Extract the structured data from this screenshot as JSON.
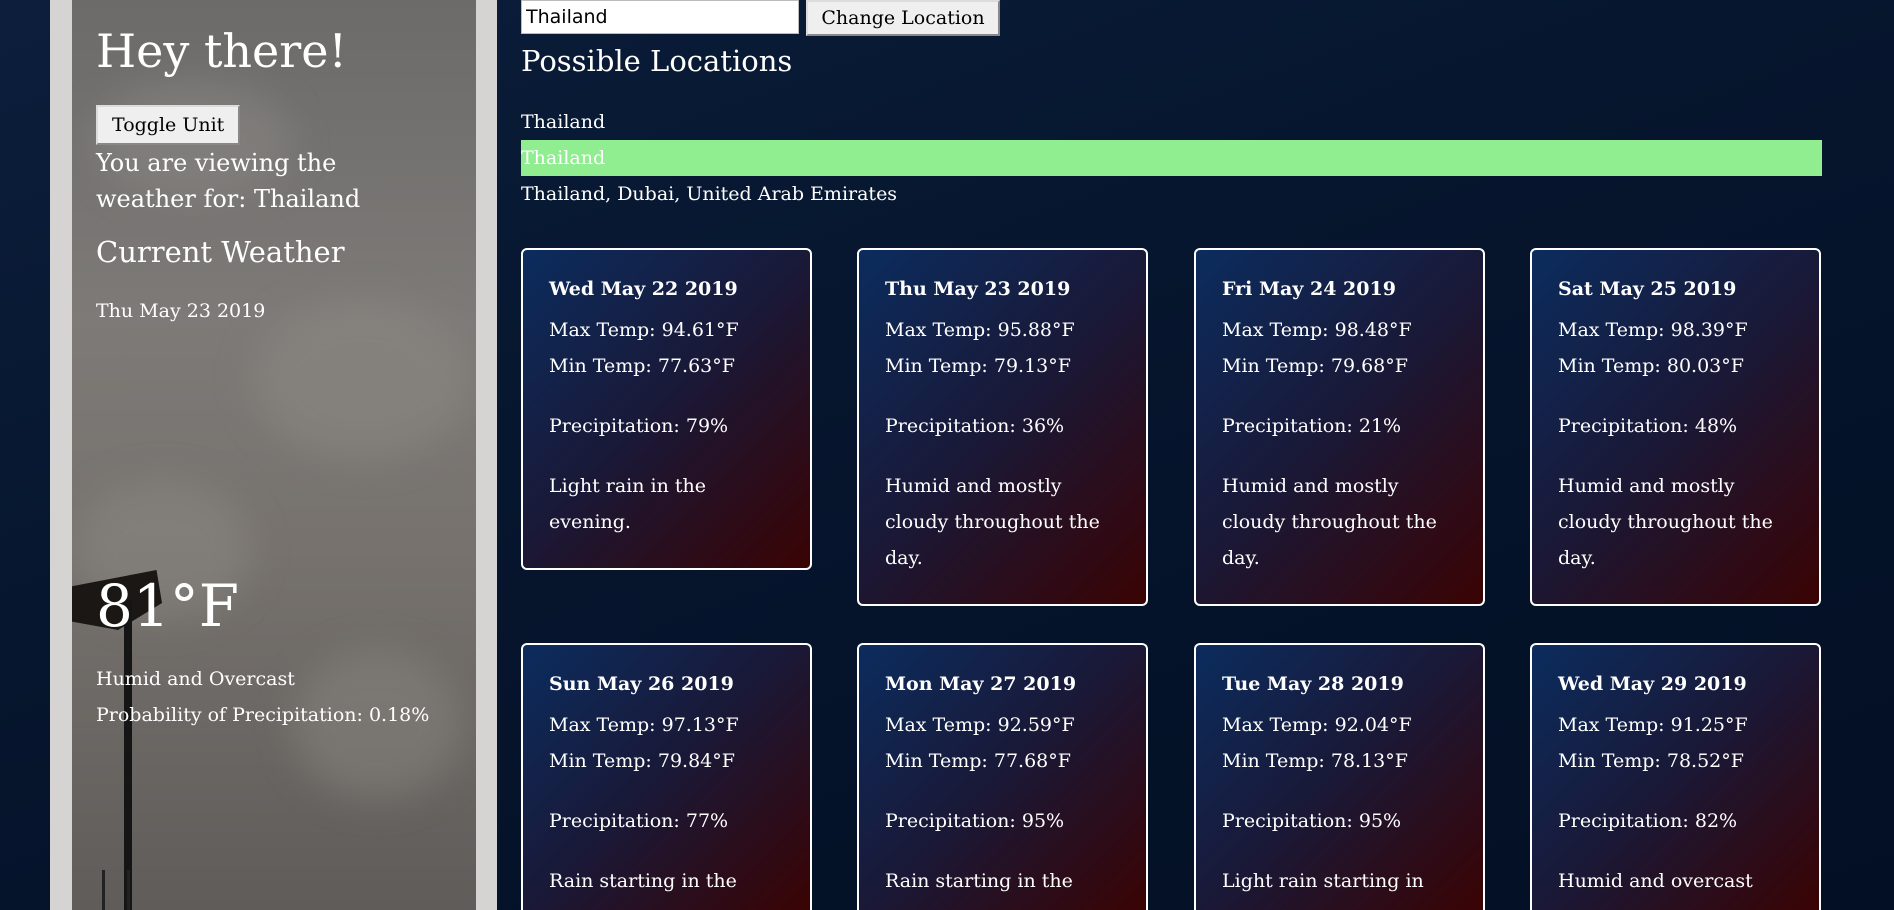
{
  "sidebar": {
    "greeting": "Hey there!",
    "toggle_label": "Toggle Unit",
    "viewing_text": "You are viewing the weather for: Thailand",
    "current_title": "Current Weather",
    "current_date": "Thu May 23 2019",
    "current_temp": "81°F",
    "current_summary": "Humid and Overcast",
    "current_precip": "Probability of Precipitation: 0.18%"
  },
  "search": {
    "value": "Thailand",
    "button_label": "Change Location"
  },
  "locations": {
    "title": "Possible Locations",
    "items": [
      "Thailand",
      "Thailand",
      "Thailand, Dubai, United Arab Emirates"
    ],
    "selected_index": 1,
    "selected_color": "#90ee90"
  },
  "forecast": [
    {
      "date": "Wed May 22 2019",
      "max": "Max Temp: 94.61°F",
      "min": "Min Temp: 77.63°F",
      "precip": "Precipitation: 79%",
      "summary": "Light rain in the evening."
    },
    {
      "date": "Thu May 23 2019",
      "max": "Max Temp: 95.88°F",
      "min": "Min Temp: 79.13°F",
      "precip": "Precipitation: 36%",
      "summary": "Humid and mostly cloudy throughout the day."
    },
    {
      "date": "Fri May 24 2019",
      "max": "Max Temp: 98.48°F",
      "min": "Min Temp: 79.68°F",
      "precip": "Precipitation: 21%",
      "summary": "Humid and mostly cloudy throughout the day."
    },
    {
      "date": "Sat May 25 2019",
      "max": "Max Temp: 98.39°F",
      "min": "Min Temp: 80.03°F",
      "precip": "Precipitation: 48%",
      "summary": "Humid and mostly cloudy throughout the day."
    },
    {
      "date": "Sun May 26 2019",
      "max": "Max Temp: 97.13°F",
      "min": "Min Temp: 79.84°F",
      "precip": "Precipitation: 77%",
      "summary": "Rain starting in the"
    },
    {
      "date": "Mon May 27 2019",
      "max": "Max Temp: 92.59°F",
      "min": "Min Temp: 77.68°F",
      "precip": "Precipitation: 95%",
      "summary": "Rain starting in the"
    },
    {
      "date": "Tue May 28 2019",
      "max": "Max Temp: 92.04°F",
      "min": "Min Temp: 78.13°F",
      "precip": "Precipitation: 95%",
      "summary": "Light rain starting in"
    },
    {
      "date": "Wed May 29 2019",
      "max": "Max Temp: 91.25°F",
      "min": "Min Temp: 78.52°F",
      "precip": "Precipitation: 82%",
      "summary": "Humid and overcast"
    }
  ]
}
